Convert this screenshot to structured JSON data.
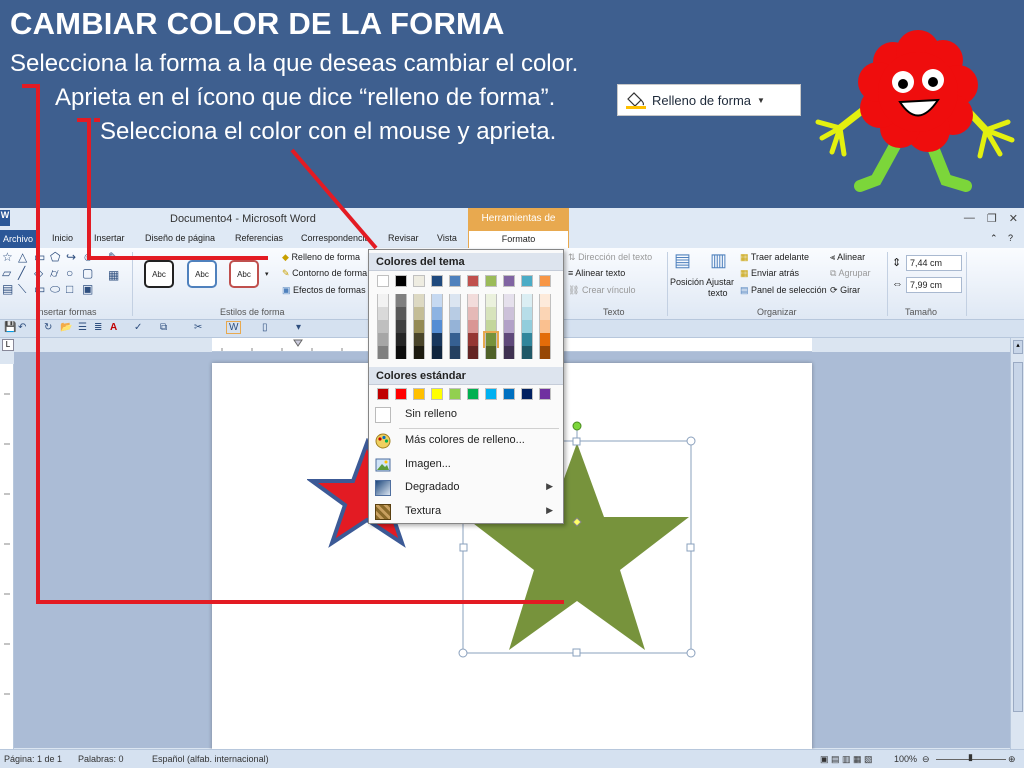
{
  "slide": {
    "title": "CAMBIAR COLOR DE LA FORMA",
    "line1": "Selecciona la forma a la que deseas cambiar el color.",
    "line2": "Aprieta en el ícono que dice “relleno de forma”.",
    "line3": "Selecciona el color con el mouse y aprieta.",
    "preview_button": "Relleno de forma"
  },
  "word": {
    "title": "Documento4  -  Microsoft Word",
    "context_tab": "Herramientas de dibujo",
    "tabs": {
      "archivo": "Archivo",
      "inicio": "Inicio",
      "insertar": "Insertar",
      "diseno": "Diseño de página",
      "referencias": "Referencias",
      "correspondencia": "Correspondencia",
      "revisar": "Revisar",
      "vista": "Vista",
      "formato": "Formato"
    },
    "ribbon": {
      "insertar_formas": "Insertar formas",
      "estilos_forma": "Estilos de forma",
      "abc": "Abc",
      "relleno": "Relleno de forma",
      "contorno": "Contorno de forma",
      "efectos": "Efectos de formas",
      "direccion_texto": "Dirección del texto",
      "alinear_texto": "Alinear texto",
      "crear_vinculo": "Crear vínculo",
      "texto": "Texto",
      "posicion": "Posición",
      "ajustar": "Ajustar",
      "texto_sub": "texto",
      "traer": "Traer adelante",
      "enviar": "Enviar atrás",
      "panel": "Panel de selección",
      "alinear": "Alinear",
      "agrupar": "Agrupar",
      "girar": "Girar",
      "organizar": "Organizar",
      "height": "7,44 cm",
      "width": "7,99 cm",
      "tamano": "Tamaño"
    },
    "status": {
      "pagina": "Página: 1 de 1",
      "palabras": "Palabras: 0",
      "idioma": "Español (alfab. internacional)",
      "zoom": "100%"
    }
  },
  "dropdown": {
    "theme_header": "Colores del tema",
    "standard_header": "Colores estándar",
    "sin_relleno": "Sin relleno",
    "mas_colores": "Más colores de relleno...",
    "imagen": "Imagen...",
    "degradado": "Degradado",
    "textura": "Textura",
    "theme_colors": [
      "#ffffff",
      "#000000",
      "#eeece1",
      "#1f497d",
      "#4f81bd",
      "#c0504d",
      "#9bbb59",
      "#8064a2",
      "#4bacc6",
      "#f79646"
    ],
    "theme_shades": [
      [
        "#f2f2f2",
        "#d9d9d9",
        "#bfbfbf",
        "#a6a6a6",
        "#808080"
      ],
      [
        "#7f7f7f",
        "#595959",
        "#404040",
        "#262626",
        "#0d0d0d"
      ],
      [
        "#ddd9c3",
        "#c4bd97",
        "#948a54",
        "#4a452a",
        "#1d1b10"
      ],
      [
        "#c6d9f1",
        "#8db3e2",
        "#548dd4",
        "#17365d",
        "#0f243e"
      ],
      [
        "#dbe5f1",
        "#b8cce4",
        "#95b3d7",
        "#366092",
        "#244061"
      ],
      [
        "#f2dcdb",
        "#e5b9b7",
        "#d99694",
        "#953734",
        "#632423"
      ],
      [
        "#ebf1dd",
        "#d7e3bc",
        "#c3d69b",
        "#76923c",
        "#4f6128"
      ],
      [
        "#e5e0ec",
        "#ccc1d9",
        "#b2a1c7",
        "#5f497a",
        "#3f3151"
      ],
      [
        "#dbeef3",
        "#b7dde8",
        "#92cddc",
        "#31859b",
        "#205867"
      ],
      [
        "#fdeada",
        "#fbd5b5",
        "#fac08f",
        "#e36c09",
        "#974806"
      ]
    ],
    "standard_colors": [
      "#c00000",
      "#ff0000",
      "#ffc000",
      "#ffff00",
      "#92d050",
      "#00b050",
      "#00b0f0",
      "#0070c0",
      "#002060",
      "#7030a0"
    ]
  },
  "colors": {
    "slide_bg": "#3e5f8f",
    "star_green": "#77933c",
    "star_red": "#e31b23",
    "star_blue": "#3c5a96",
    "annotation_red": "#e31b23"
  }
}
